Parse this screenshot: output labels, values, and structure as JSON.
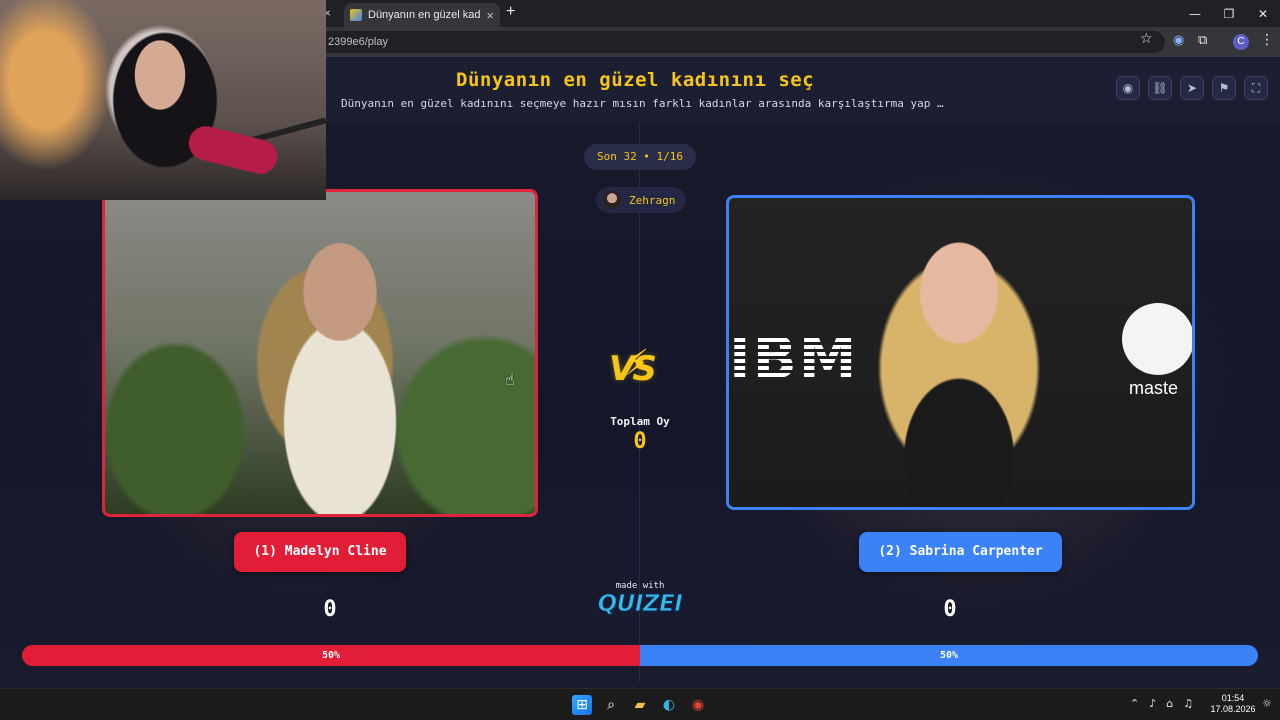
{
  "browser": {
    "tab_title": "Dünyanın en güzel kadınını seç",
    "tab_close": "×",
    "prev_tab_close": "×",
    "new_tab": "+",
    "url": "2399e6/play",
    "window_controls": [
      "—",
      "❐",
      "✕"
    ]
  },
  "header": {
    "title": "Dünyanın en güzel kadınını seç",
    "subtitle": "Dünyanın en güzel kadınını seçmeye hazır mısın farklı kadınlar arasında karşılaştırma yap …",
    "icons": [
      "eye-icon",
      "link-icon",
      "send-icon",
      "flag-icon",
      "fullscreen-icon"
    ]
  },
  "round": {
    "label": "Son 32 • 1/16"
  },
  "host": {
    "name": "Zehragn"
  },
  "left": {
    "button_label": "(1) Madelyn Cline",
    "score": "0",
    "bar_percent": 50,
    "bar_label": "50%"
  },
  "right": {
    "button_label": "(2) Sabrina Carpenter",
    "score": "0",
    "bar_percent": 50,
    "bar_label": "50%",
    "photo_bg_text_1": "IBM",
    "photo_bg_text_2": "maste"
  },
  "center": {
    "vs_text": "VS",
    "total_votes_label": "Toplam Oy",
    "total_votes": "0",
    "made_with": "made with",
    "brand": "QUIZEI"
  },
  "taskbar": {
    "time": "01:54",
    "date": "17.08.2026",
    "tray_icons": [
      "chevron-up-icon",
      "microphone-icon",
      "network-icon",
      "volume-icon"
    ]
  },
  "colors": {
    "accent_yellow": "#f5c518",
    "left_red": "#e11d37",
    "right_blue": "#3b82f6"
  }
}
